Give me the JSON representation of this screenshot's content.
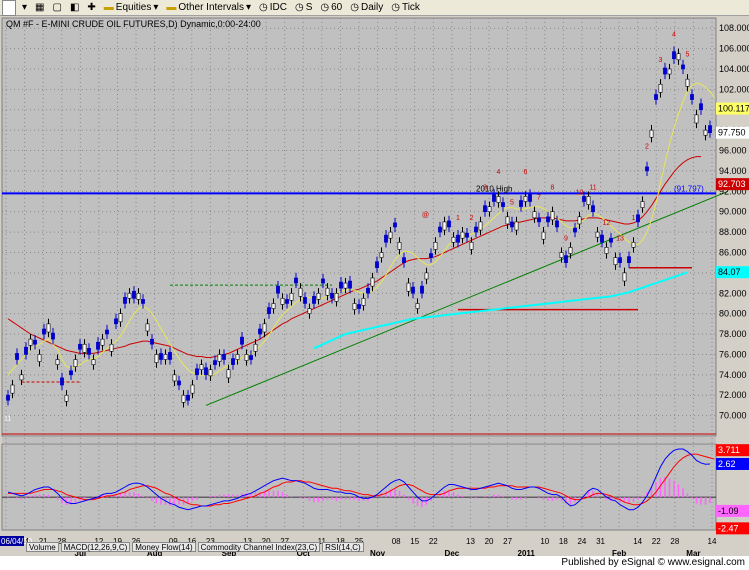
{
  "toolbar": {
    "symbol_box": "",
    "equities_label": "Equities",
    "intervals_label": "Other Intervals",
    "idc_label": "IDC",
    "s_label": "S",
    "num_label": "60",
    "daily_label": "Daily",
    "tick_label": "Tick"
  },
  "chart_title": "QM #F - E-MINI CRUDE OIL FUTURES,D) Dynamic,0:00-24:00",
  "bottom_tabs": [
    "Volume",
    "MACD(12,26,9,C)",
    "Money Flow(14)",
    "Commodity Channel Index(23,C)",
    "RSI(14,C)"
  ],
  "footer": {
    "published": "Published by eSignal © www.esignal.com"
  },
  "annotations": {
    "high_label": "2010 High",
    "high_value_label": "(91.797)",
    "upper_count": [
      "1",
      "2",
      "3",
      "4",
      "5",
      "6",
      "7",
      "8",
      "9",
      "10",
      "11",
      "12",
      "13",
      "1",
      "2",
      "3",
      "4",
      "5"
    ],
    "tag_a": "@",
    "tag_b": "11"
  },
  "price_badges": {
    "last_hi": "100.117",
    "last": "97.750",
    "high_line": "92.703",
    "ma_long": "84.07"
  },
  "macd_badges": {
    "m1": "3.711",
    "m2": "2.62",
    "m3": "-1.09",
    "m4": "-2.47"
  },
  "start_date_label": "06/04/10",
  "colors": {
    "bg": "#c0c0c0",
    "up": "#000000",
    "down": "#0000cc",
    "ma_fast": "#ffff66",
    "ma_mid": "#cc0000",
    "ma_slow": "#00ffff",
    "trend": "#008000",
    "macd": "#0000ff",
    "signal": "#ff0000",
    "hist": "#ff66ff"
  },
  "chart_data": {
    "type": "candlestick",
    "title": "QM #F - E-MINI CRUDE OIL FUTURES,D) Dynamic,0:00-24:00",
    "y_ticks": [
      70,
      72,
      74,
      76,
      78,
      80,
      82,
      84,
      86,
      88,
      90,
      92,
      94,
      96,
      98,
      100,
      102,
      104,
      106,
      108
    ],
    "ylim": [
      68,
      109
    ],
    "x_tick_labels": [
      "06/04/10",
      "14",
      "21",
      "28",
      "Jul",
      "12",
      "19",
      "26",
      "Aug",
      "09",
      "16",
      "23",
      "Sep",
      "13",
      "20",
      "27",
      "Oct",
      "11",
      "18",
      "25",
      "Nov",
      "08",
      "15",
      "22",
      "Dec",
      "13",
      "20",
      "27",
      "2011",
      "10",
      "18",
      "24",
      "31",
      "Feb",
      "14",
      "22",
      "28",
      "Mar",
      "14"
    ],
    "x_ticks_major": [
      "Jul",
      "Aug",
      "Sep",
      "Oct",
      "Nov",
      "Dec",
      "2011",
      "Feb",
      "Mar"
    ],
    "macd_ticks": [],
    "close": [
      71.5,
      73,
      75.5,
      74,
      76,
      77.5,
      77,
      76,
      78,
      79,
      77.5,
      75.5,
      73,
      72,
      74,
      75.5,
      76.5,
      77,
      76,
      75.5,
      76.5,
      77.5,
      78,
      77,
      79,
      80,
      81,
      82,
      81.5,
      82,
      81,
      79,
      77,
      76,
      75.5,
      76,
      75.5,
      74,
      73,
      72,
      71.5,
      73,
      74,
      75,
      74,
      74.5,
      75,
      76,
      75.5,
      74.5,
      75,
      76,
      77,
      76,
      75.5,
      77,
      78,
      79,
      80,
      81,
      82,
      81.5,
      81,
      82,
      83,
      82.5,
      81,
      80.5,
      81,
      82,
      83,
      82.5,
      81.5,
      82,
      82.5,
      83,
      82.5,
      81,
      80.5,
      81.5,
      82,
      83.5,
      84.5,
      86,
      87,
      88,
      88.5,
      87,
      85,
      83,
      82,
      81,
      82,
      84,
      85.5,
      87,
      88,
      89,
      88.5,
      87.5,
      87,
      88,
      87.5,
      87,
      88,
      89,
      90,
      90.5,
      91,
      91.5,
      90.5,
      89.5,
      88.5,
      89,
      90.5,
      91.5,
      91,
      90,
      89,
      88,
      89,
      90,
      88.5,
      86,
      85,
      86.5,
      88,
      89.5,
      91,
      91.5,
      90,
      88,
      87,
      86.5,
      87,
      85.5,
      85,
      84,
      85,
      87,
      89,
      91,
      94,
      98,
      101,
      102.5,
      103.5,
      104,
      105,
      105.5,
      104,
      103,
      101,
      99.5,
      100,
      98,
      97.75
    ],
    "open_offset": [
      0.5,
      -0.8,
      0.6,
      -0.5,
      0.7,
      -0.6,
      0.4,
      -0.7
    ],
    "sma_fast": [
      74,
      74.5,
      75,
      75.5,
      76,
      76.5,
      76.8,
      77,
      77.3,
      77.5,
      77,
      76.5,
      75.5,
      74.8,
      74.7,
      74.8,
      75,
      75.3,
      75.5,
      75.6,
      75.8,
      76.2,
      76.6,
      76.9,
      77.3,
      77.8,
      78.5,
      79.3,
      80,
      80.5,
      80.7,
      80.5,
      80,
      79.3,
      78.5,
      77.8,
      77,
      76.3,
      75.6,
      75,
      74.5,
      74.2,
      74,
      74,
      73.9,
      73.9,
      74.1,
      74.4,
      74.7,
      74.9,
      75.1,
      75.4,
      75.7,
      75.9,
      76.1,
      76.4,
      76.8,
      77.3,
      77.9,
      78.6,
      79.3,
      79.9,
      80.3,
      80.7,
      81.1,
      81.4,
      81.6,
      81.6,
      81.5,
      81.4,
      81.5,
      81.7,
      81.9,
      82,
      82.2,
      82.3,
      82.4,
      82.3,
      82.1,
      82,
      82,
      82.2,
      82.6,
      83.1,
      83.8,
      84.6,
      85.3,
      85.8,
      86.1,
      86.1,
      85.9,
      85.5,
      85.1,
      84.8,
      84.8,
      85.1,
      85.6,
      86.2,
      86.8,
      87.2,
      87.4,
      87.5,
      87.7,
      87.8,
      88,
      88.3,
      88.6,
      89,
      89.4,
      89.8,
      90.2,
      90.4,
      90.4,
      90.3,
      90.2,
      90.3,
      90.4,
      90.5,
      90.5,
      90.3,
      90,
      89.7,
      89.4,
      89,
      88.6,
      88.4,
      88.5,
      88.8,
      89.2,
      89.6,
      89.8,
      89.7,
      89.4,
      89,
      88.6,
      88.2,
      87.8,
      87.4,
      87,
      86.8,
      86.8,
      87.2,
      88,
      89.2,
      90.8,
      92.8,
      94.8,
      96.6,
      98.2,
      99.6,
      100.8,
      101.8,
      102.4,
      102.6,
      102.5,
      102.2,
      101.8,
      101.2
    ],
    "sma_mid": [
      79.5,
      79.2,
      78.9,
      78.6,
      78.3,
      78,
      77.8,
      77.6,
      77.4,
      77.2,
      77,
      76.8,
      76.6,
      76.4,
      76.3,
      76.2,
      76.1,
      76.1,
      76.1,
      76.1,
      76.2,
      76.3,
      76.4,
      76.5,
      76.6,
      76.7,
      76.8,
      77,
      77.1,
      77.2,
      77.3,
      77.3,
      77.2,
      77.1,
      77,
      76.9,
      76.8,
      76.6,
      76.4,
      76.2,
      76,
      75.9,
      75.8,
      75.8,
      75.7,
      75.7,
      75.8,
      75.9,
      76,
      76.1,
      76.3,
      76.5,
      76.7,
      76.9,
      77.1,
      77.3,
      77.5,
      77.8,
      78.1,
      78.4,
      78.7,
      79,
      79.2,
      79.5,
      79.7,
      79.9,
      80.1,
      80.3,
      80.5,
      80.7,
      80.9,
      81.1,
      81.3,
      81.5,
      81.7,
      81.9,
      82.1,
      82.3,
      82.4,
      82.6,
      82.8,
      83,
      83.2,
      83.5,
      83.8,
      84.1,
      84.4,
      84.7,
      85,
      85.2,
      85.3,
      85.4,
      85.4,
      85.4,
      85.5,
      85.6,
      85.8,
      86,
      86.2,
      86.4,
      86.6,
      86.8,
      87,
      87.2,
      87.4,
      87.6,
      87.8,
      88,
      88.2,
      88.4,
      88.6,
      88.7,
      88.8,
      88.9,
      89,
      89.1,
      89.2,
      89.3,
      89.4,
      89.4,
      89.4,
      89.4,
      89.3,
      89.2,
      89.1,
      89.1,
      89.1,
      89.2,
      89.3,
      89.4,
      89.4,
      89.4,
      89.3,
      89.2,
      89.1,
      89,
      88.9,
      88.8,
      88.8,
      88.9,
      89.1,
      89.5,
      90,
      90.6,
      91.3,
      92,
      92.7,
      93.3,
      93.9,
      94.4,
      94.8,
      95.1,
      95.3,
      95.4,
      95.4
    ],
    "sma_slow": [
      null,
      null,
      null,
      null,
      null,
      null,
      null,
      null,
      null,
      null,
      null,
      null,
      null,
      null,
      null,
      null,
      null,
      null,
      null,
      null,
      null,
      null,
      null,
      null,
      null,
      null,
      null,
      null,
      null,
      null,
      null,
      null,
      null,
      null,
      null,
      null,
      null,
      null,
      null,
      null,
      null,
      null,
      null,
      null,
      null,
      null,
      null,
      null,
      null,
      null,
      null,
      null,
      null,
      null,
      null,
      null,
      null,
      null,
      null,
      null,
      null,
      null,
      null,
      null,
      null,
      null,
      null,
      null,
      76.6,
      76.8,
      77,
      77.2,
      77.4,
      77.6,
      77.8,
      78,
      78.1,
      78.2,
      78.3,
      78.4,
      78.5,
      78.6,
      78.7,
      78.8,
      78.9,
      79,
      79.1,
      79.2,
      79.3,
      79.4,
      79.5,
      79.55,
      79.6,
      79.65,
      79.7,
      79.75,
      79.8,
      79.85,
      79.9,
      79.95,
      80,
      80.05,
      80.1,
      80.15,
      80.2,
      80.25,
      80.3,
      80.35,
      80.4,
      80.45,
      80.5,
      80.55,
      80.6,
      80.65,
      80.7,
      80.75,
      80.8,
      80.85,
      80.9,
      80.95,
      81,
      81.05,
      81.1,
      81.15,
      81.2,
      81.25,
      81.3,
      81.35,
      81.4,
      81.45,
      81.5,
      81.55,
      81.6,
      81.65,
      81.7,
      81.8,
      81.9,
      82,
      82.1,
      82.25,
      82.4,
      82.55,
      82.7,
      82.85,
      83,
      83.15,
      83.3,
      83.45,
      83.6,
      83.75,
      83.9,
      84.07
    ],
    "levels": {
      "high_2010": 91.797,
      "hline1_y": 82.8,
      "hline2_y": 80.4,
      "hline3_y": 84.5,
      "hline4_y": 73.3
    },
    "macd": [
      0.4,
      0.3,
      0.2,
      0.1,
      0.2,
      0.4,
      0.6,
      0.7,
      0.8,
      0.8,
      0.6,
      0.3,
      -0.1,
      -0.4,
      -0.5,
      -0.5,
      -0.4,
      -0.3,
      -0.2,
      -0.1,
      0,
      0.2,
      0.3,
      0.3,
      0.4,
      0.6,
      0.8,
      1,
      1.1,
      1.1,
      1,
      0.8,
      0.5,
      0.2,
      -0.1,
      -0.3,
      -0.5,
      -0.6,
      -0.8,
      -0.9,
      -1,
      -0.9,
      -0.8,
      -0.7,
      -0.7,
      -0.6,
      -0.5,
      -0.4,
      -0.3,
      -0.3,
      -0.2,
      -0.1,
      0.1,
      0.2,
      0.3,
      0.5,
      0.7,
      0.9,
      1.1,
      1.3,
      1.4,
      1.5,
      1.4,
      1.3,
      1.3,
      1.2,
      1.1,
      0.9,
      0.7,
      0.6,
      0.6,
      0.6,
      0.5,
      0.4,
      0.4,
      0.3,
      0.3,
      0.2,
      0,
      -0.1,
      -0.1,
      0,
      0.2,
      0.5,
      0.8,
      1.1,
      1.3,
      1.4,
      1.2,
      0.8,
      0.4,
      0,
      -0.3,
      -0.3,
      -0.1,
      0.2,
      0.5,
      0.8,
      1,
      1,
      0.9,
      0.8,
      0.7,
      0.6,
      0.6,
      0.7,
      0.8,
      0.9,
      1,
      1.1,
      1,
      0.9,
      0.7,
      0.6,
      0.6,
      0.7,
      0.8,
      0.8,
      0.7,
      0.5,
      0.3,
      0.2,
      0.2,
      0,
      -0.4,
      -0.7,
      -0.6,
      -0.3,
      0.1,
      0.5,
      0.7,
      0.6,
      0.3,
      0,
      -0.2,
      -0.3,
      -0.6,
      -0.8,
      -1,
      -1,
      -0.8,
      -0.4,
      0.1,
      0.8,
      1.6,
      2.4,
      3,
      3.4,
      3.7,
      3.8,
      3.8,
      3.6,
      3.3,
      2.9,
      2.7,
      2.6,
      2.62
    ],
    "signal": [
      0.3,
      0.3,
      0.3,
      0.3,
      0.3,
      0.3,
      0.4,
      0.5,
      0.6,
      0.6,
      0.6,
      0.5,
      0.4,
      0.2,
      0.1,
      0,
      -0.1,
      -0.2,
      -0.2,
      -0.2,
      -0.1,
      0,
      0.1,
      0.1,
      0.2,
      0.3,
      0.4,
      0.6,
      0.7,
      0.8,
      0.9,
      0.9,
      0.8,
      0.7,
      0.5,
      0.3,
      0.2,
      0,
      -0.2,
      -0.3,
      -0.5,
      -0.6,
      -0.6,
      -0.7,
      -0.7,
      -0.7,
      -0.6,
      -0.6,
      -0.5,
      -0.5,
      -0.4,
      -0.3,
      -0.2,
      -0.1,
      0,
      0.1,
      0.3,
      0.4,
      0.6,
      0.8,
      0.9,
      1.1,
      1.2,
      1.2,
      1.3,
      1.3,
      1.2,
      1.2,
      1.1,
      1,
      0.9,
      0.8,
      0.7,
      0.7,
      0.6,
      0.5,
      0.5,
      0.4,
      0.3,
      0.2,
      0.2,
      0.1,
      0.1,
      0.2,
      0.3,
      0.5,
      0.7,
      0.9,
      1,
      1,
      0.9,
      0.7,
      0.5,
      0.3,
      0.2,
      0.2,
      0.2,
      0.3,
      0.5,
      0.6,
      0.7,
      0.7,
      0.7,
      0.7,
      0.7,
      0.7,
      0.7,
      0.8,
      0.8,
      0.9,
      0.9,
      0.9,
      0.9,
      0.8,
      0.8,
      0.8,
      0.8,
      0.8,
      0.8,
      0.7,
      0.6,
      0.5,
      0.4,
      0.3,
      0.1,
      -0.1,
      -0.2,
      -0.2,
      -0.1,
      0,
      0.2,
      0.3,
      0.3,
      0.2,
      0.1,
      -0.1,
      -0.2,
      -0.4,
      -0.5,
      -0.6,
      -0.6,
      -0.5,
      -0.3,
      0,
      0.4,
      0.9,
      1.4,
      1.9,
      2.4,
      2.8,
      3.1,
      3.3,
      3.4,
      3.4,
      3.3,
      3.2,
      3.1,
      3.0
    ]
  }
}
